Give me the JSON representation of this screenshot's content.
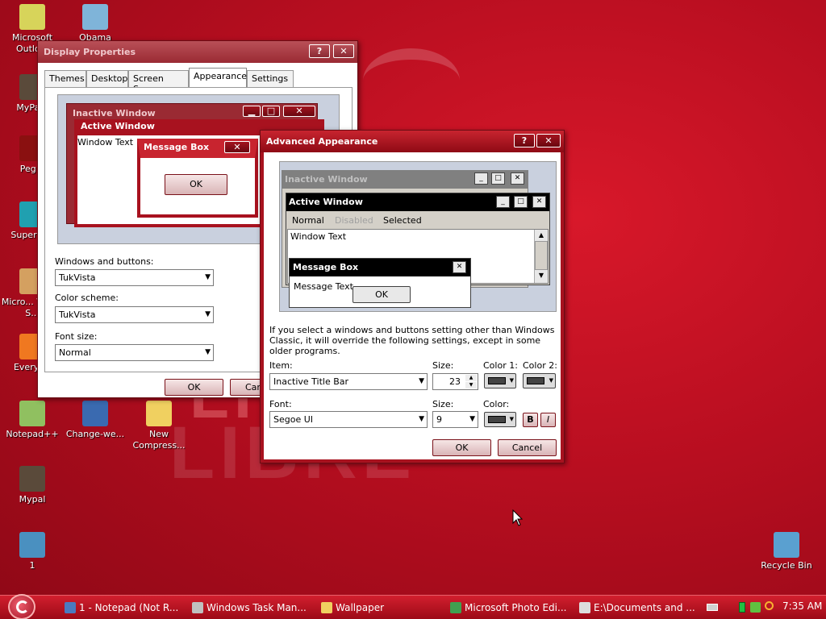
{
  "desktop": {
    "icons": [
      {
        "label": "Microsoft Outlo...",
        "name": "outlook-icon",
        "color": "#d7d45a"
      },
      {
        "label": "Obama",
        "name": "obama-image-icon",
        "color": "#7fb4d9"
      },
      {
        "label": "MyPa...",
        "name": "mypal-shortcut-icon",
        "color": "#5a4a3a"
      },
      {
        "label": "Peg...",
        "name": "peg-icon",
        "color": "#8a1010"
      },
      {
        "label": "Superm...",
        "name": "superm-icon",
        "color": "#20a0b0"
      },
      {
        "label": "Micro... Visual S...",
        "name": "visual-studio-icon",
        "color": "#d4a060"
      },
      {
        "label": "Everyt...",
        "name": "everything-icon",
        "color": "#f07820"
      },
      {
        "label": "Notepad++",
        "name": "notepadpp-icon",
        "color": "#90c060"
      },
      {
        "label": "Change-we...",
        "name": "change-we-icon",
        "color": "#3a6ab0"
      },
      {
        "label": "New Compress...",
        "name": "zip-folder-icon",
        "color": "#f0d060"
      },
      {
        "label": "Mypal",
        "name": "mypal-icon",
        "color": "#5a4a3a"
      },
      {
        "label": "1",
        "name": "file-1-icon",
        "color": "#4a90c0"
      },
      {
        "label": "Recycle Bin",
        "name": "recycle-bin-icon",
        "color": "#5aa0d0"
      }
    ],
    "bg_words": [
      "LIBRE",
      "LIBRE"
    ]
  },
  "display_properties": {
    "title": "Display Properties",
    "help": "?",
    "close": "✕",
    "tabs": [
      "Themes",
      "Desktop",
      "Screen Saver",
      "Appearance",
      "Settings"
    ],
    "preview": {
      "inactive_title": "Inactive Window",
      "active_title": "Active Window",
      "window_text": "Window Text",
      "message_box_title": "Message Box",
      "ok": "OK"
    },
    "windows_buttons_label": "Windows and buttons:",
    "windows_buttons_value": "TukVista",
    "color_scheme_label": "Color scheme:",
    "color_scheme_value": "TukVista",
    "font_size_label": "Font size:",
    "font_size_value": "Normal",
    "ok": "OK",
    "cancel": "Can"
  },
  "advanced": {
    "title": "Advanced Appearance",
    "help": "?",
    "close": "✕",
    "preview": {
      "inactive_title": "Inactive Window",
      "active_title": "Active Window",
      "menu": [
        "Normal",
        "Disabled",
        "Selected"
      ],
      "window_text": "Window Text",
      "message_box_title": "Message Box",
      "message_text": "Message Text",
      "ok": "OK"
    },
    "info": "If you select a windows and buttons setting other than Windows Classic, it will override the following settings, except in some older programs.",
    "item_label": "Item:",
    "item_value": "Inactive Title Bar",
    "size_label": "Size:",
    "size_value": "23",
    "color1_label": "Color 1:",
    "color2_label": "Color 2:",
    "font_label": "Font:",
    "font_value": "Segoe UI",
    "font_size_label": "Size:",
    "font_size_value": "9",
    "color_label": "Color:",
    "bold": "B",
    "italic": "I",
    "ok": "OK",
    "cancel": "Cancel"
  },
  "taskbar": {
    "items": [
      {
        "label": "1 - Notepad (Not R...",
        "color": "#4a7ac0"
      },
      {
        "label": "Windows Task Man...",
        "color": "#c0c0c0"
      },
      {
        "label": "Wallpaper",
        "color": "#f0d060"
      },
      {
        "label": "Microsoft Photo Edi...",
        "color": "#40a050"
      },
      {
        "label": "E:\\Documents and ...",
        "color": "#dddddd"
      }
    ],
    "clock": "7:35 AM"
  }
}
